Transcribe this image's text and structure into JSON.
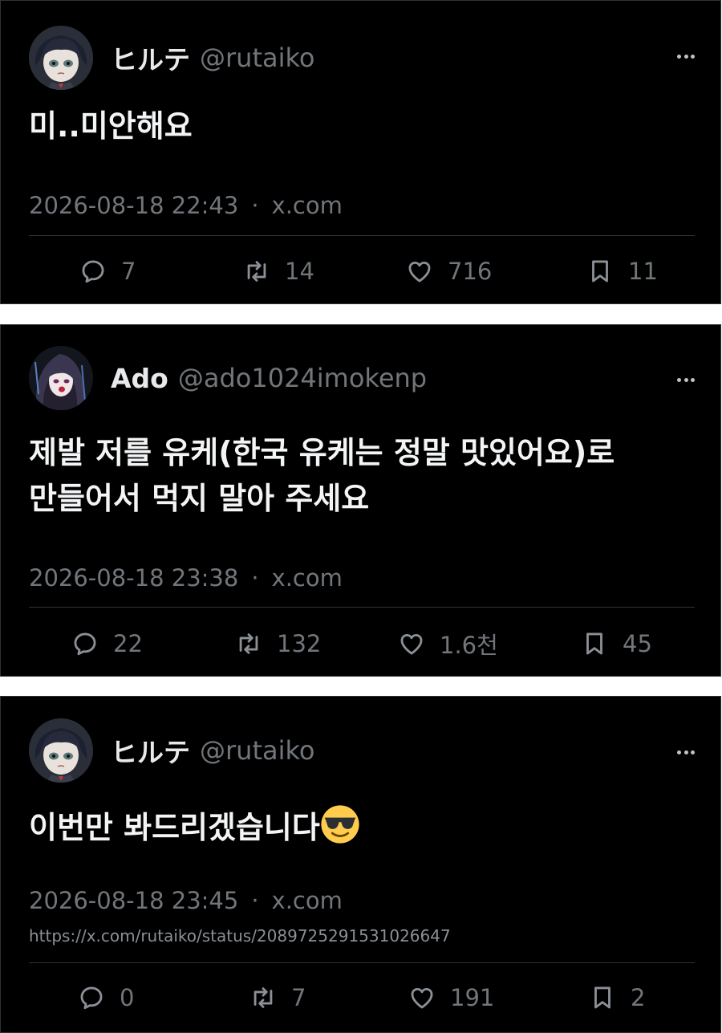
{
  "tweets": [
    {
      "display_name": "ヒルテ",
      "handle": "@rutaiko",
      "avatar": "rutaiko-avatar",
      "text": "미..미안해요",
      "timestamp": "2026-08-18 22:43",
      "separator": "·",
      "source": "x.com",
      "replies": "7",
      "retweets": "14",
      "likes": "716",
      "bookmarks": "11"
    },
    {
      "display_name": "Ado",
      "handle": "@ado1024imokenp",
      "avatar": "ado-avatar",
      "text_line1": "제발 저를 유케(한국 유케는 정말 맛있어요)로",
      "text_line2": "만들어서 먹지 말아 주세요",
      "timestamp": "2026-08-18 23:38",
      "separator": "·",
      "source": "x.com",
      "replies": "22",
      "retweets": "132",
      "likes": "1.6천",
      "bookmarks": "45"
    },
    {
      "display_name": "ヒルテ",
      "handle": "@rutaiko",
      "avatar": "rutaiko-avatar",
      "text": "이번만 봐드리겠습니다",
      "emoji": "sunglasses-emoji",
      "timestamp": "2026-08-18 23:45",
      "separator": "·",
      "source": "x.com",
      "url": "https://x.com/rutaiko/status/2089725291531026647",
      "replies": "0",
      "retweets": "7",
      "likes": "191",
      "bookmarks": "2"
    }
  ],
  "colors": {
    "background": "#000000",
    "text": "#e7e9ea",
    "secondary": "#71767b",
    "border": "#2f3336"
  },
  "icons": [
    "reply-icon",
    "retweet-icon",
    "like-icon",
    "bookmark-icon",
    "more-options-icon"
  ]
}
